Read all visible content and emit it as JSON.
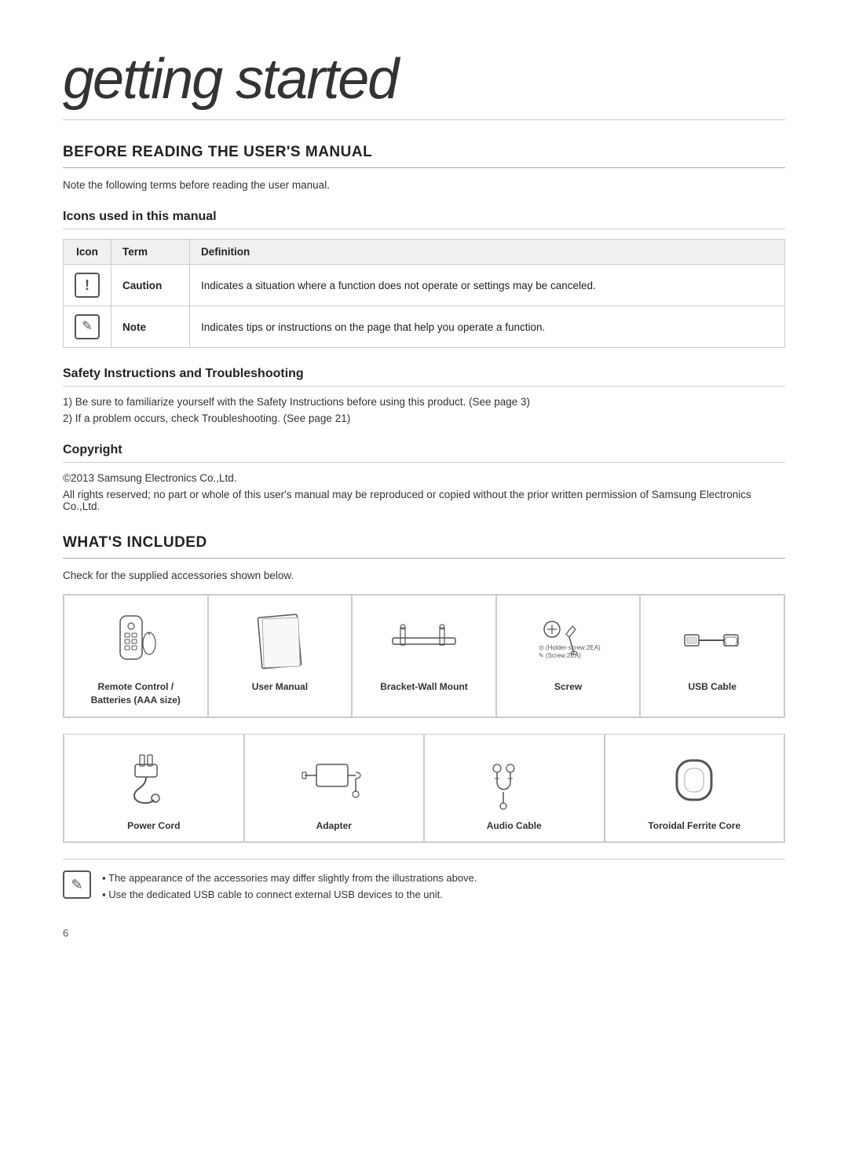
{
  "page": {
    "title": "getting started",
    "page_number": "6"
  },
  "before_reading": {
    "section_title": "BEFORE READING THE USER'S MANUAL",
    "note": "Note the following terms before reading the user manual.",
    "icons_section": {
      "title": "Icons used in this manual",
      "table_headers": [
        "Icon",
        "Term",
        "Definition"
      ],
      "rows": [
        {
          "icon_type": "caution",
          "term": "Caution",
          "definition": "Indicates a situation where a function does not operate or settings may be canceled."
        },
        {
          "icon_type": "note",
          "term": "Note",
          "definition": "Indicates tips or instructions on the page that help you operate a function."
        }
      ]
    },
    "safety_section": {
      "title": "Safety Instructions and Troubleshooting",
      "items": [
        "Be sure to familiarize yourself with the Safety Instructions before using this product. (See page 3)",
        "If a problem occurs, check Troubleshooting. (See page 21)"
      ]
    },
    "copyright_section": {
      "title": "Copyright",
      "year_text": "©2013 Samsung Electronics Co.,Ltd.",
      "body": "All rights reserved; no part or whole of this user's manual may be reproduced or copied without the prior written permission of Samsung Electronics Co.,Ltd."
    }
  },
  "whats_included": {
    "section_title": "WHAT'S INCLUDED",
    "intro": "Check for the supplied accessories shown below.",
    "accessories_row1": [
      {
        "label": "Remote Control /\nBatteries (AAA size)",
        "icon": "remote-control"
      },
      {
        "label": "User Manual",
        "icon": "user-manual"
      },
      {
        "label": "Bracket-Wall Mount",
        "icon": "bracket-wall-mount"
      },
      {
        "label": "Screw",
        "icon": "screw",
        "sub_text": "(Holder-screw:2EA)\n(Screw:2EA)"
      },
      {
        "label": "USB Cable",
        "icon": "usb-cable"
      }
    ],
    "accessories_row2": [
      {
        "label": "Power Cord",
        "icon": "power-cord"
      },
      {
        "label": "Adapter",
        "icon": "adapter"
      },
      {
        "label": "Audio Cable",
        "icon": "audio-cable"
      },
      {
        "label": "Toroidal Ferrite Core",
        "icon": "toroidal-ferrite-core"
      }
    ],
    "notes": [
      "The appearance of the accessories may differ slightly from the illustrations above.",
      "Use the dedicated USB cable to connect external USB devices to the unit."
    ]
  }
}
